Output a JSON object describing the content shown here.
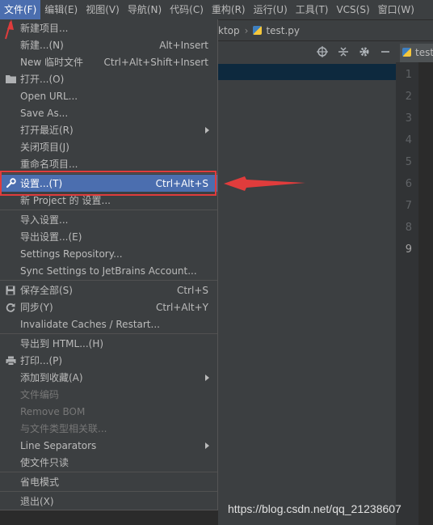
{
  "menubar": {
    "items": [
      {
        "label": "文件(F)",
        "active": true
      },
      {
        "label": "编辑(E)"
      },
      {
        "label": "视图(V)"
      },
      {
        "label": "导航(N)"
      },
      {
        "label": "代码(C)"
      },
      {
        "label": "重构(R)"
      },
      {
        "label": "运行(U)"
      },
      {
        "label": "工具(T)"
      },
      {
        "label": "VCS(S)"
      },
      {
        "label": "窗口(W)"
      }
    ]
  },
  "navbar": {
    "crumb_partial": "ktop",
    "file": "test.py"
  },
  "editor": {
    "tab_label": "test",
    "line_numbers": [
      "1",
      "2",
      "3",
      "4",
      "5",
      "6",
      "7",
      "8",
      "9"
    ],
    "current_line": "9"
  },
  "file_menu": {
    "items": [
      {
        "label": "新建项目..."
      },
      {
        "label": "新建...(N)",
        "shortcut": "Alt+Insert"
      },
      {
        "label": "New 临时文件",
        "shortcut": "Ctrl+Alt+Shift+Insert"
      },
      {
        "label": "打开...(O)",
        "icon": "folder-icon"
      },
      {
        "label": "Open URL..."
      },
      {
        "label": "Save As..."
      },
      {
        "label": "打开最近(R)",
        "submenu": true
      },
      {
        "label": "关闭项目(J)"
      },
      {
        "label": "重命名项目..."
      },
      {
        "label": "设置...(T)",
        "shortcut": "Ctrl+Alt+S",
        "icon": "wrench-icon",
        "selected": true
      },
      {
        "label": "新 Project 的 设置..."
      },
      {
        "label": "导入设置..."
      },
      {
        "label": "导出设置...(E)"
      },
      {
        "label": "Settings Repository..."
      },
      {
        "label": "Sync Settings to JetBrains Account..."
      },
      {
        "label": "保存全部(S)",
        "shortcut": "Ctrl+S",
        "icon": "save-icon"
      },
      {
        "label": "同步(Y)",
        "shortcut": "Ctrl+Alt+Y",
        "icon": "sync-icon"
      },
      {
        "label": "Invalidate Caches / Restart..."
      },
      {
        "label": "导出到 HTML...(H)"
      },
      {
        "label": "打印...(P)",
        "icon": "print-icon"
      },
      {
        "label": "添加到收藏(A)",
        "submenu": true
      },
      {
        "label": "文件编码",
        "disabled": true
      },
      {
        "label": "Remove BOM",
        "disabled": true
      },
      {
        "label": "与文件类型相关联...",
        "disabled": true
      },
      {
        "label": "Line Separators",
        "submenu": true
      },
      {
        "label": "使文件只读"
      },
      {
        "label": "省电模式"
      },
      {
        "label": "退出(X)"
      }
    ]
  },
  "watermark": "https://blog.csdn.net/qq_21238607",
  "colors": {
    "accent": "#4b6eaf",
    "annotation": "#e03c3c",
    "menu_bg": "#3c3f41"
  }
}
